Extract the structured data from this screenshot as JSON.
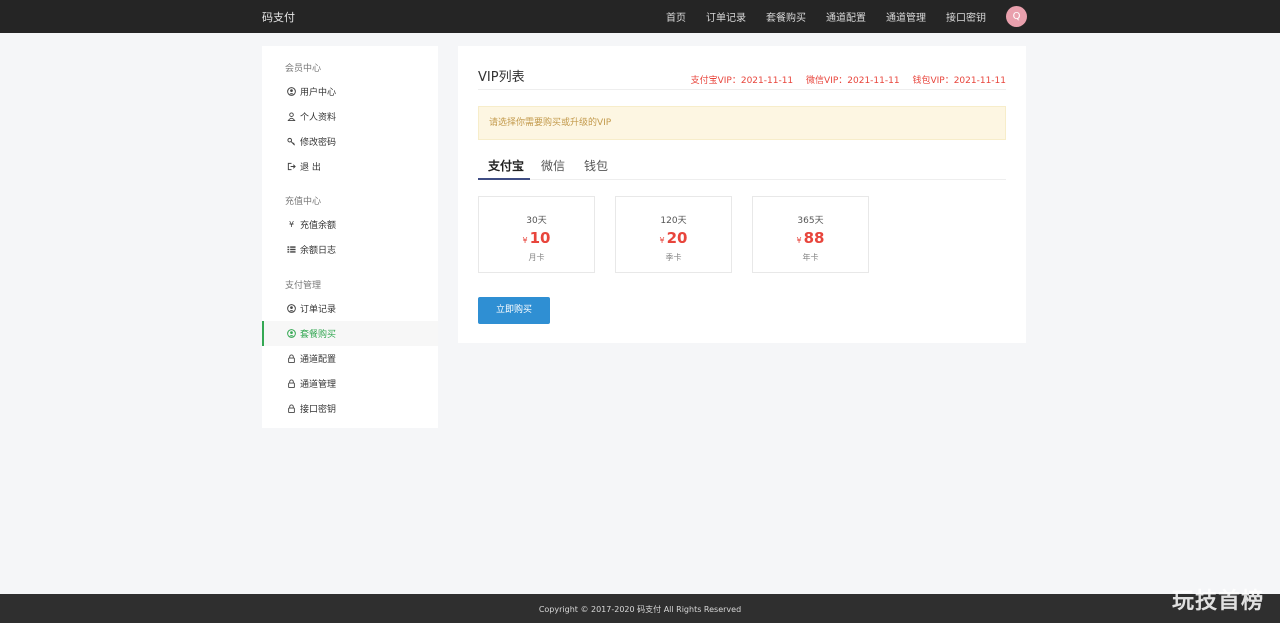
{
  "header": {
    "brand": "码支付",
    "nav": [
      "首页",
      "订单记录",
      "套餐购买",
      "通道配置",
      "通道管理",
      "接口密钥"
    ],
    "avatar_letter": "Q"
  },
  "sidebar": {
    "sections": [
      {
        "title": "会员中心",
        "items": [
          {
            "label": "用户中心",
            "icon": "user-circle-icon"
          },
          {
            "label": "个人资料",
            "icon": "user-icon"
          },
          {
            "label": "修改密码",
            "icon": "key-icon"
          },
          {
            "label": "退 出",
            "icon": "logout-icon"
          }
        ]
      },
      {
        "title": "充值中心",
        "items": [
          {
            "label": "充值余额",
            "icon": "yen-icon"
          },
          {
            "label": "余额日志",
            "icon": "list-icon"
          }
        ]
      },
      {
        "title": "支付管理",
        "items": [
          {
            "label": "订单记录",
            "icon": "user-circle-icon"
          },
          {
            "label": "套餐购买",
            "icon": "user-circle-icon",
            "active": true
          },
          {
            "label": "通道配置",
            "icon": "lock-icon"
          },
          {
            "label": "通道管理",
            "icon": "lock-icon"
          },
          {
            "label": "接口密钥",
            "icon": "lock-icon"
          }
        ]
      }
    ]
  },
  "main": {
    "title": "VIP列表",
    "vip_status": [
      "支付宝VIP：2021-11-11",
      "微信VIP：2021-11-11",
      "钱包VIP：2021-11-11"
    ],
    "alert": "请选择你需要购买或升级的VIP",
    "tabs": [
      "支付宝",
      "微信",
      "钱包"
    ],
    "active_tab": "支付宝",
    "plans": [
      {
        "days": "30天",
        "currency": "¥",
        "price": "10",
        "label": "月卡"
      },
      {
        "days": "120天",
        "currency": "¥",
        "price": "20",
        "label": "季卡"
      },
      {
        "days": "365天",
        "currency": "¥",
        "price": "88",
        "label": "年卡"
      }
    ],
    "buy_button": "立即购买"
  },
  "footer": {
    "copyright": "Copyright © 2017-2020 码支付 All Rights Reserved"
  },
  "watermark": "玩技首榜",
  "colors": {
    "topbar": "#252525",
    "accent_green": "#34a853",
    "price_red": "#e8453c",
    "button_blue": "#2f8fd3",
    "alert_bg": "#fdf6e2"
  }
}
